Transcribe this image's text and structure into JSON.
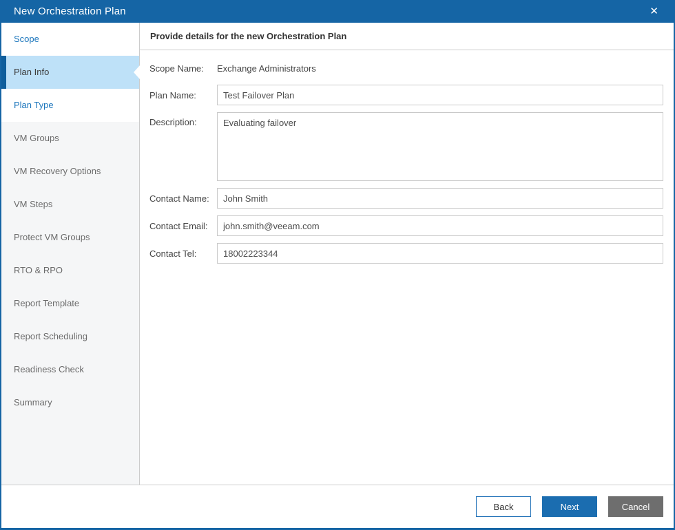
{
  "window": {
    "title": "New Orchestration Plan",
    "close_icon": "✕"
  },
  "sidebar": {
    "steps": [
      {
        "label": "Scope",
        "state": "enabled"
      },
      {
        "label": "Plan Info",
        "state": "active"
      },
      {
        "label": "Plan Type",
        "state": "enabled"
      },
      {
        "label": "VM Groups",
        "state": "disabled"
      },
      {
        "label": "VM Recovery Options",
        "state": "disabled"
      },
      {
        "label": "VM Steps",
        "state": "disabled"
      },
      {
        "label": "Protect VM Groups",
        "state": "disabled"
      },
      {
        "label": "RTO & RPO",
        "state": "disabled"
      },
      {
        "label": "Report Template",
        "state": "disabled"
      },
      {
        "label": "Report Scheduling",
        "state": "disabled"
      },
      {
        "label": "Readiness Check",
        "state": "disabled"
      },
      {
        "label": "Summary",
        "state": "disabled"
      }
    ]
  },
  "content": {
    "header": "Provide details for the new Orchestration Plan",
    "fields": {
      "scope_name": {
        "label": "Scope Name:",
        "value": "Exchange Administrators"
      },
      "plan_name": {
        "label": "Plan Name:",
        "value": "Test Failover Plan"
      },
      "description": {
        "label": "Description:",
        "value": "Evaluating failover"
      },
      "contact_name": {
        "label": "Contact Name:",
        "value": "John Smith"
      },
      "contact_email": {
        "label": "Contact Email:",
        "value": "john.smith@veeam.com"
      },
      "contact_tel": {
        "label": "Contact Tel:",
        "value": "18002223344"
      }
    }
  },
  "footer": {
    "back_label": "Back",
    "next_label": "Next",
    "cancel_label": "Cancel"
  },
  "colors": {
    "titlebar_blue": "#1565A5",
    "active_step_bg": "#BEE1F8",
    "active_step_accent": "#0F5E9C",
    "step_link_blue": "#1C76BC",
    "next_button_blue": "#1B6DB0",
    "cancel_button_gray": "#6E6E6E",
    "sidebar_gray": "#F5F6F7",
    "divider_gray": "#CCCCCC"
  }
}
